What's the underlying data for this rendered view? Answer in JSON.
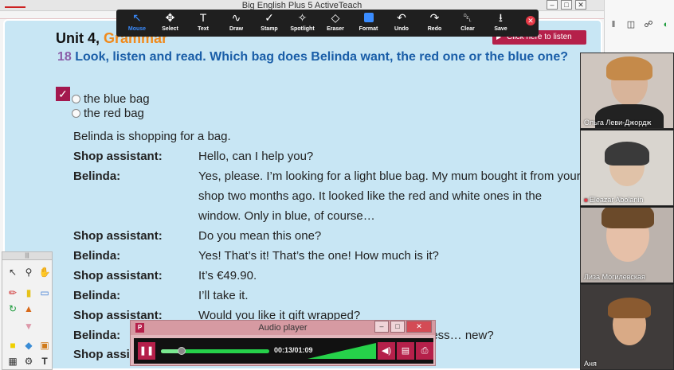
{
  "app": {
    "title": "Big English Plus 5 ActiveTeach"
  },
  "toolbar": {
    "tools": [
      {
        "label": "Mouse",
        "icon": "cursor-icon",
        "glyph": "↖",
        "active": true
      },
      {
        "label": "Select",
        "icon": "move-icon",
        "glyph": "✥"
      },
      {
        "label": "Text",
        "icon": "text-icon",
        "glyph": "T"
      },
      {
        "label": "Draw",
        "icon": "draw-icon",
        "glyph": "∿"
      },
      {
        "label": "Stamp",
        "icon": "check-icon",
        "glyph": "✓"
      },
      {
        "label": "Spotlight",
        "icon": "spotlight-icon",
        "glyph": "✧"
      },
      {
        "label": "Eraser",
        "icon": "eraser-icon",
        "glyph": "◇"
      },
      {
        "label": "Format",
        "icon": "format-swatch-icon",
        "glyph": ""
      },
      {
        "label": "Undo",
        "icon": "undo-icon",
        "glyph": "↶"
      },
      {
        "label": "Redo",
        "icon": "redo-icon",
        "glyph": "↷"
      },
      {
        "label": "Clear",
        "icon": "trash-icon",
        "glyph": "␡"
      },
      {
        "label": "Save",
        "icon": "save-icon",
        "glyph": "⭳"
      }
    ],
    "close_glyph": "✕",
    "accent": "#3a8cff"
  },
  "page": {
    "unit_prefix": "Unit 4,",
    "unit_accent": "Grammar",
    "listen_label": "Click here to listen",
    "exercise_number": "18",
    "exercise_text": "Look, listen and read. Which bag does Belinda want, the red one or the blue one?",
    "check_glyph": "✓",
    "options": [
      "the blue bag",
      "the red bag"
    ],
    "intro": "Belinda is shopping for a bag.",
    "dialogue": [
      {
        "speaker": "Shop assistant:",
        "line": "Hello, can I help you?"
      },
      {
        "speaker": "Belinda:",
        "line": "Yes, please. I’m looking for a light blue bag. My mum bought it from your shop two months ago. It looked like the red and white ones in the window. Only in blue, of course…"
      },
      {
        "speaker": "Shop assistant:",
        "line": "Do you mean this one?"
      },
      {
        "speaker": "Belinda:",
        "line": "Yes! That’s it! That’s the one! How much is it?"
      },
      {
        "speaker": "Shop assistant:",
        "line": "It’s €49.90."
      },
      {
        "speaker": "Belinda:",
        "line": "I’ll take it."
      },
      {
        "speaker": "Shop assistant:",
        "line": "Would you like it gift wrapped?"
      },
      {
        "speaker": "Belinda:",
        "line": "No, thanks. It’s for me. Hmm… and it looks less… new?"
      },
      {
        "speaker": "Shop assistant:",
        "line": ""
      }
    ],
    "colors": {
      "background": "#c8e6f4",
      "heading": "#1a5ea8",
      "brand": "#b5204a",
      "accent_orange": "#f08a1c"
    }
  },
  "audio_player": {
    "title": "Audio player",
    "time": "00:13/01:09",
    "progress": 0.19,
    "play_glyph": "❚❚",
    "volume_glyph": "◀)",
    "transcript_glyph": "▤",
    "print_glyph": "⎙"
  },
  "participants": [
    {
      "name": "Ольга Леви-Джордж",
      "muted": false
    },
    {
      "name": "Eleazar Abolanin",
      "muted": true
    },
    {
      "name": "Лиза Могилевская",
      "muted": false
    },
    {
      "name": "Аня",
      "muted": false
    }
  ]
}
